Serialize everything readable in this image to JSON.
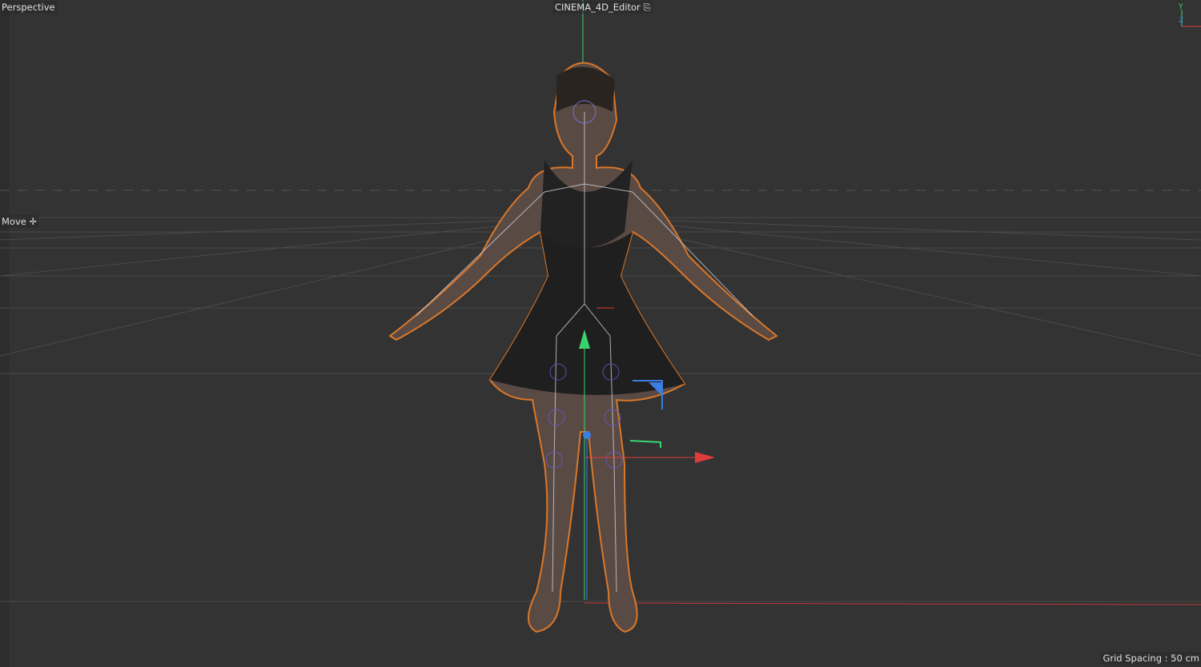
{
  "viewport": {
    "view_name": "Perspective",
    "camera": "CINEMA_4D_Editor",
    "camera_icon": "camera-icon",
    "tool": "Move",
    "tool_icon": "move-cross-icon",
    "grid_spacing": "Grid Spacing : 50 cm",
    "axis_labels": {
      "y": "Y",
      "z": "Z"
    },
    "colors": {
      "background": "#333333",
      "x_axis": "#e03b3b",
      "y_axis": "#3ad36b",
      "z_axis": "#3b7de0",
      "selection_outline": "#d9772a"
    }
  }
}
